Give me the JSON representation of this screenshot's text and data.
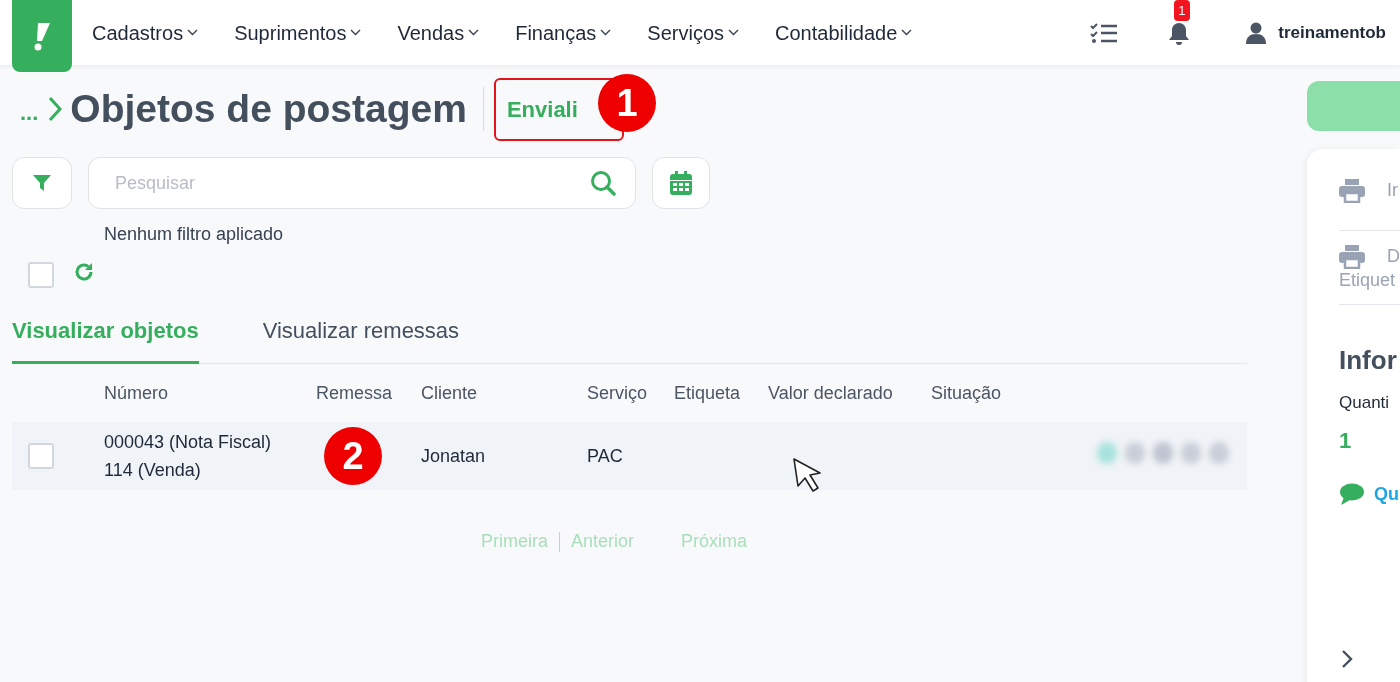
{
  "nav": {
    "menus": [
      {
        "label": "Cadastros"
      },
      {
        "label": "Suprimentos"
      },
      {
        "label": "Vendas"
      },
      {
        "label": "Finanças"
      },
      {
        "label": "Serviços"
      },
      {
        "label": "Contabilidade"
      }
    ],
    "notification_count": "1",
    "user": "treinamentob"
  },
  "header": {
    "ellipsis": "...",
    "title": "Objetos de postagem",
    "integration": "Enviali"
  },
  "search": {
    "placeholder": "Pesquisar"
  },
  "filter_status": "Nenhum filtro aplicado",
  "select_all": {
    "checked": false
  },
  "tabs": [
    {
      "label": "Visualizar objetos",
      "selected": true
    },
    {
      "label": "Visualizar remessas",
      "selected": false
    }
  ],
  "table": {
    "columns": [
      "Número",
      "Remessa",
      "Cliente",
      "Serviço",
      "Etiqueta",
      "Valor declarado",
      "Situação"
    ],
    "rows": [
      {
        "checked": false,
        "numero": [
          "000043 (Nota Fiscal)",
          "114 (Venda)"
        ],
        "cliente": "Jonatan",
        "servico": "PAC"
      }
    ]
  },
  "pagination": [
    {
      "label": "Primeira",
      "disabled": true
    },
    {
      "label": "Anterior",
      "disabled": true
    },
    {
      "label": "Próxima",
      "disabled": true
    }
  ],
  "side_panel": {
    "actions": [
      {
        "label": "Ir"
      },
      {
        "label": "D",
        "sublabel": "Etiquet"
      }
    ],
    "heading": "Infor",
    "quantity_label": "Quanti",
    "quantity_value": "1",
    "link": "Qu"
  },
  "callouts": [
    {
      "number": "1"
    },
    {
      "number": "2"
    }
  ]
}
